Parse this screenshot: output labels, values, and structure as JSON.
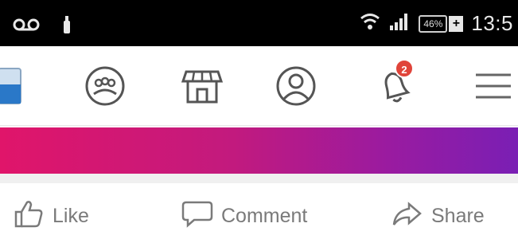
{
  "status_bar": {
    "time": "13:5",
    "battery_percent": "46%",
    "battery_plus": "+",
    "icons": [
      "voicemail-icon",
      "usb-icon",
      "wifi-icon",
      "signal-icon",
      "battery-icon"
    ]
  },
  "nav": {
    "notification_count": "2",
    "icons": [
      "app-thumbnail-icon",
      "friends-icon",
      "marketplace-icon",
      "profile-icon",
      "notifications-bell-icon",
      "menu-icon"
    ]
  },
  "actions": {
    "like_label": "Like",
    "comment_label": "Comment",
    "share_label": "Share"
  },
  "colors": {
    "banner_start": "#e0156a",
    "banner_end": "#7a1fb4",
    "badge": "#e0443a",
    "icon_gray": "#7a7a7a"
  }
}
